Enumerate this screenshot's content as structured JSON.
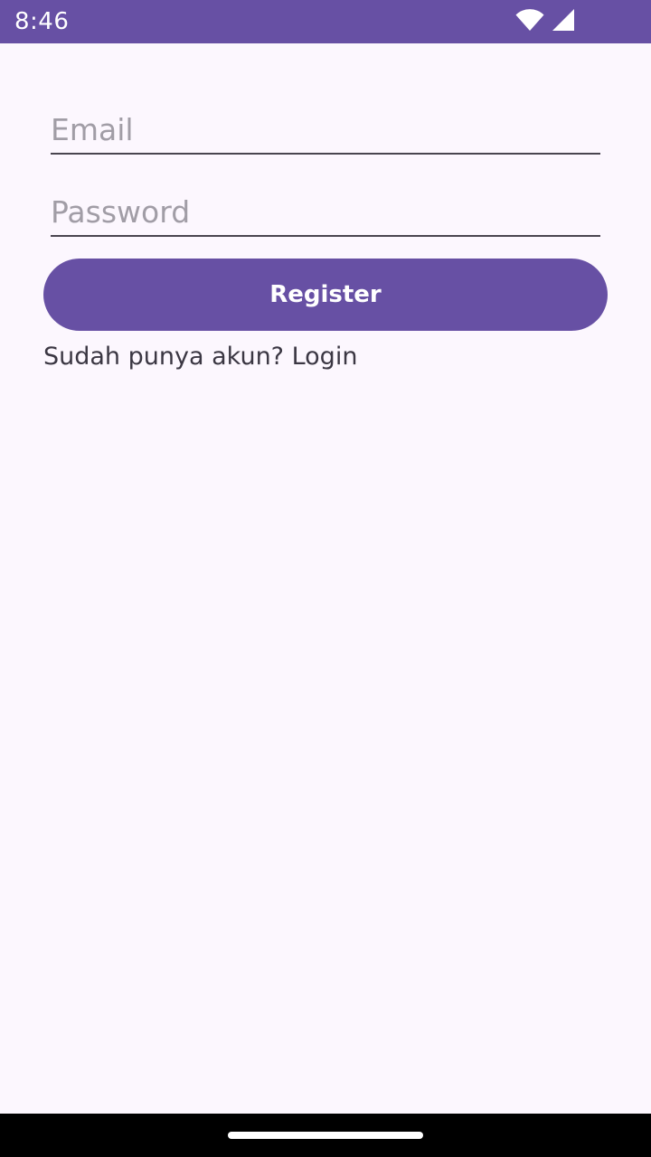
{
  "status_bar": {
    "time": "8:46",
    "background_color": "#6750a4",
    "icons": [
      "wifi-icon",
      "cellular-signal-icon"
    ]
  },
  "form": {
    "email": {
      "value": "",
      "placeholder": "Email"
    },
    "password": {
      "value": "",
      "placeholder": "Password"
    },
    "register_label": "Register",
    "login_prompt": "Sudah punya akun? Login"
  },
  "colors": {
    "primary": "#6750a4",
    "background": "#fcf7fe",
    "placeholder": "#a19da6",
    "text": "#3b3743"
  }
}
